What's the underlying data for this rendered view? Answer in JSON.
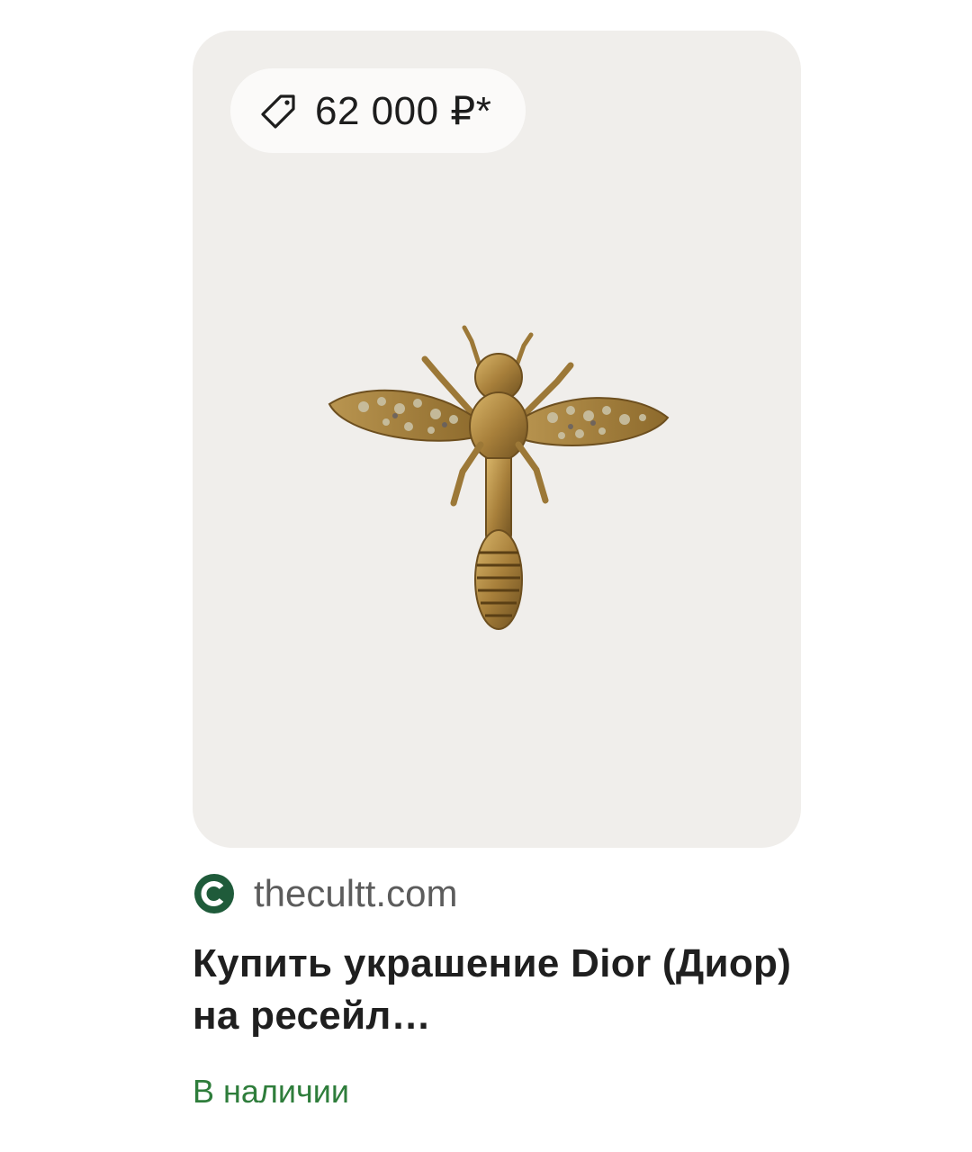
{
  "card": {
    "price": "62 000 ₽*",
    "price_icon": "tag-icon",
    "source": {
      "favicon": "thecultt-favicon",
      "domain": "thecultt.com"
    },
    "title": "Купить украшение Dior (Диор) на ресейл…",
    "availability": "В наличии"
  },
  "colors": {
    "image_background": "#f0eeeb",
    "availability_green": "#2e7d3b",
    "favicon_green": "#1f5b3a"
  }
}
